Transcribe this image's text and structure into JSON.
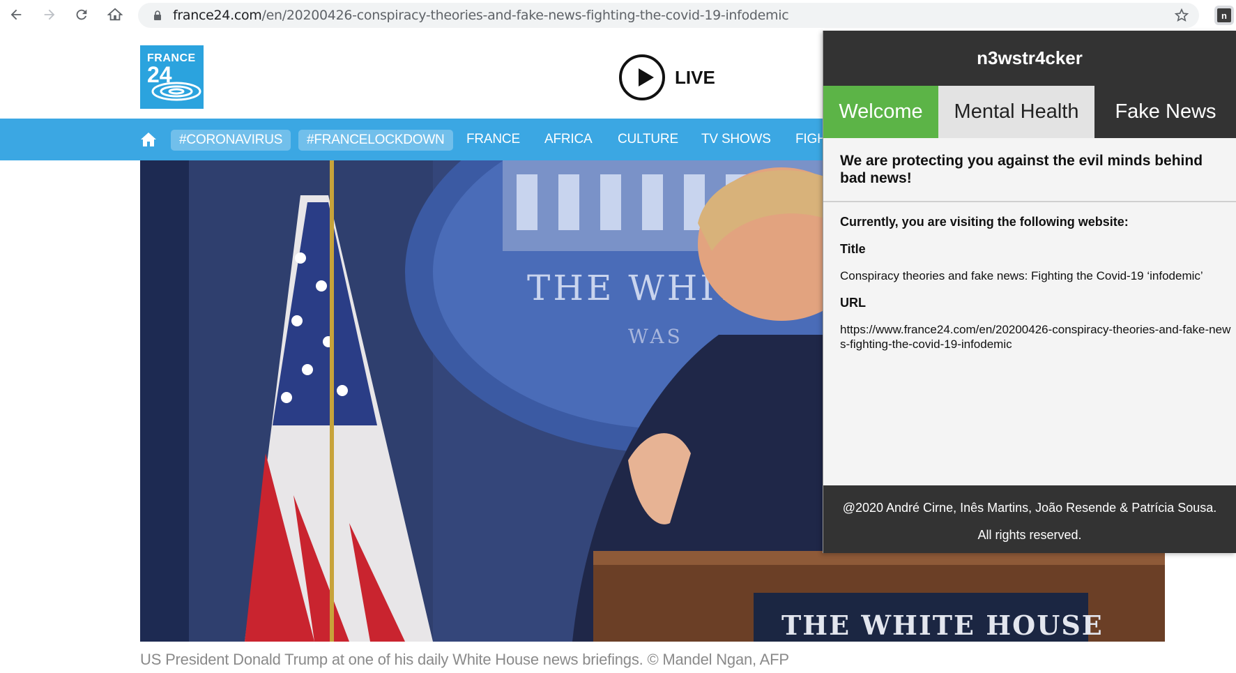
{
  "browser": {
    "url_host": "france24.com",
    "url_path": "/en/20200426-conspiracy-theories-and-fake-news-fighting-the-covid-19-infodemic",
    "extension_letter": "n"
  },
  "site": {
    "logo_top": "FRANCE",
    "logo_bottom": "24",
    "live_label": "LIVE",
    "nav": [
      "#CORONAVIRUS",
      "#FRANCELOCKDOWN",
      "FRANCE",
      "AFRICA",
      "CULTURE",
      "TV SHOWS",
      "FIGH"
    ],
    "caption": "US President Donald Trump at one of his daily White House news briefings. © Mandel Ngan, AFP",
    "image_text_top": "THE WHITE",
    "image_text_top2": "WAS",
    "image_text_bottom": "THE WHITE HOUSE"
  },
  "popup": {
    "title": "n3wstr4cker",
    "tabs": [
      "Welcome",
      "Mental Health",
      "Fake News"
    ],
    "tagline": "We are protecting you against the evil minds behind bad news!",
    "visiting_heading": "Currently, you are visiting the following website:",
    "title_label": "Title",
    "title_value": "Conspiracy theories and fake news: Fighting the Covid-19 ‘infodemic’",
    "url_label": "URL",
    "url_value": "https://www.france24.com/en/20200426-conspiracy-theories-and-fake-news-fighting-the-covid-19-infodemic",
    "footer_line1": "@2020 André Cirne, Inês Martins, João Resende & Patrícia Sousa.",
    "footer_line2": "All rights reserved."
  },
  "colors": {
    "site_blue": "#3ba7e3",
    "popup_dark": "#333333",
    "tab_active": "#5cb447"
  }
}
